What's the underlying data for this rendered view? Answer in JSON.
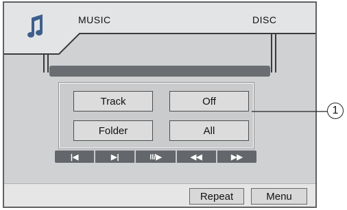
{
  "header": {
    "left_label": "MUSIC",
    "right_label": "DISC"
  },
  "icons": {
    "app": "music-note-icon"
  },
  "options": {
    "track": "Track",
    "off": "Off",
    "folder": "Folder",
    "all": "All"
  },
  "controls": {
    "prev": "|◀",
    "next": "▶|",
    "play_pause": "II/▶",
    "rewind": "◀◀",
    "fast_forward": "▶▶"
  },
  "bottom": {
    "repeat": "Repeat",
    "menu": "Menu"
  },
  "callout": {
    "number": "1"
  },
  "colors": {
    "background": "#cfd1d3",
    "bar": "#63666a",
    "border": "#5e6062"
  }
}
